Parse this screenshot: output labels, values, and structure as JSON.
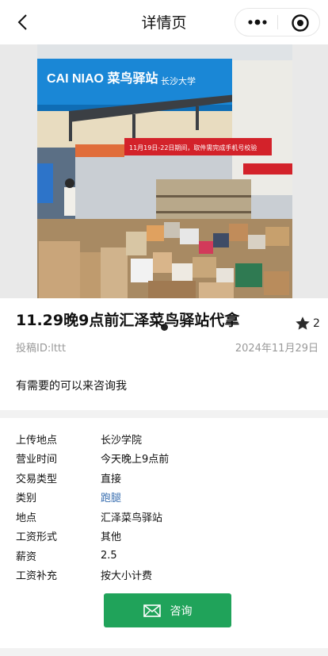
{
  "header": {
    "title": "详情页"
  },
  "carousel": {
    "favorite_count": "2"
  },
  "post": {
    "title": "11.29晚9点前汇泽菜鸟驿站代拿",
    "author_id": "投稿ID:lttt",
    "date": "2024年11月29日",
    "description": "有需要的可以来咨询我"
  },
  "details": {
    "rows": [
      {
        "label": "上传地点",
        "value": "长沙学院"
      },
      {
        "label": "营业时间",
        "value": "今天晚上9点前"
      },
      {
        "label": "交易类型",
        "value": "直接"
      },
      {
        "label": "类别",
        "value": "跑腿"
      },
      {
        "label": "地点",
        "value": "汇泽菜鸟驿站"
      },
      {
        "label": "工资形式",
        "value": "其他"
      },
      {
        "label": "薪资",
        "value": "2.5"
      },
      {
        "label": "工资补充",
        "value": "按大小计费"
      }
    ]
  },
  "photo_signage": {
    "brand": "CAI NIAO 菜鸟驿站",
    "school": "长沙大学",
    "banner": "11月19日-22日期间，取件需完成手机号校验"
  },
  "actions": {
    "consult_label": "咨询"
  },
  "colors": {
    "accent": "#20a35a",
    "link": "#3a6fb0",
    "muted": "#999999"
  }
}
